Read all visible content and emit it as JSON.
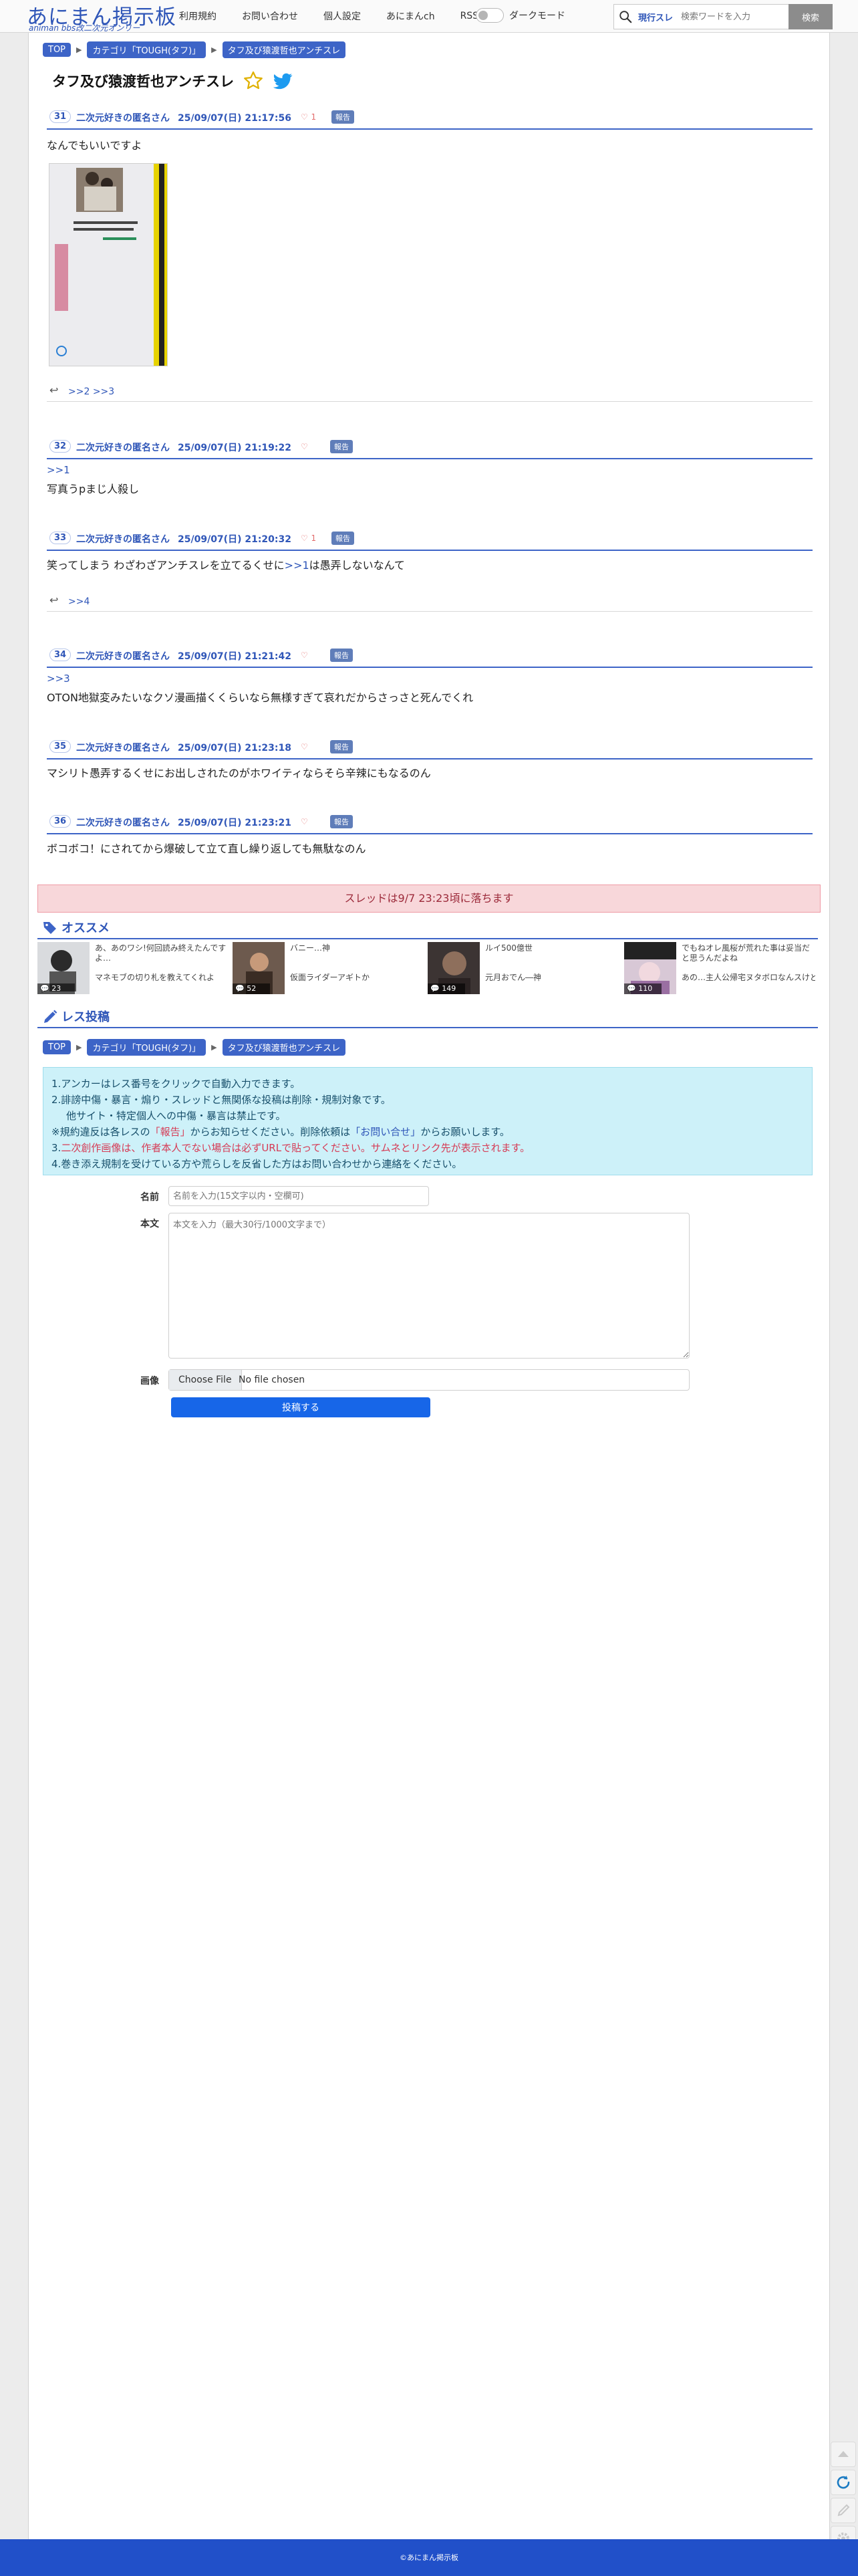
{
  "header": {
    "logo_main": "あにまん掲示板",
    "logo_sub": "animan bbs改二次元オンリー",
    "nav": [
      "利用規約",
      "お問い合わせ",
      "個人設定",
      "あにまんch",
      "RSS"
    ],
    "dark_mode_label": "ダークモード",
    "search_scope": "現行スレ",
    "search_placeholder": "検索ワードを入力",
    "search_button": "検索"
  },
  "breadcrumb": [
    "TOP",
    "カテゴリ「TOUGH(タフ)」",
    "タフ及び猿渡哲也アンチスレ"
  ],
  "thread": {
    "title": "タフ及び猿渡哲也アンチスレ"
  },
  "posts": [
    {
      "num": "31",
      "name": "二次元好きの匿名さん",
      "date": "25/09/07(日) 21:17:56",
      "likes": "1",
      "report": "報告",
      "body": "なんでもいいですよ",
      "replies": ">>2 >>3"
    },
    {
      "num": "32",
      "name": "二次元好きの匿名さん",
      "date": "25/09/07(日) 21:19:22",
      "likes": "",
      "report": "報告",
      "anchor": ">>1",
      "body": "写真うpまじ人殺し"
    },
    {
      "num": "33",
      "name": "二次元好きの匿名さん",
      "date": "25/09/07(日) 21:20:32",
      "likes": "1",
      "report": "報告",
      "body_pre": "笑ってしまう わざわざアンチスレを立てるくせに",
      "body_anchor": ">>1",
      "body_post": "は愚弄しないなんて",
      "replies": ">>4"
    },
    {
      "num": "34",
      "name": "二次元好きの匿名さん",
      "date": "25/09/07(日) 21:21:42",
      "likes": "",
      "report": "報告",
      "anchor": ">>3",
      "body": "OTON地獄変みたいなクソ漫画描くくらいなら無様すぎて哀れだからさっさと死んでくれ"
    },
    {
      "num": "35",
      "name": "二次元好きの匿名さん",
      "date": "25/09/07(日) 21:23:18",
      "likes": "",
      "report": "報告",
      "body": "マシリト愚弄するくせにお出しされたのがホワイティならそら辛辣にもなるのん"
    },
    {
      "num": "36",
      "name": "二次元好きの匿名さん",
      "date": "25/09/07(日) 21:23:21",
      "likes": "",
      "report": "報告",
      "body": "ボコボコ！にされてから爆破して立て直し繰り返しても無駄なのん"
    }
  ],
  "fall_notice": "スレッドは9/7 23:23頃に落ちます",
  "recommend": {
    "title": "オススメ",
    "items": [
      {
        "title": "あ、あのワシ!何回読み終えたんですよ…",
        "sub": "マネモブの切り札を教えてくれよ",
        "count": "23"
      },
      {
        "title": "バニー…神",
        "sub": "仮面ライダーアギトか",
        "count": "52"
      },
      {
        "title": "ルイ500億世",
        "sub": "元月おでん―神",
        "count": "149"
      },
      {
        "title": "でもねオレ風桜が荒れた事は妥当だと思うんだよね",
        "sub": "あの…主人公帰宅ヌタボロなんスけど…",
        "count": "110"
      }
    ]
  },
  "post_form": {
    "title": "レス投稿",
    "rules": [
      "1.アンカーはレス番号をクリックで自動入力できます。",
      "2.誹謗中傷・暴言・煽り・スレッドと無関係な投稿は削除・規制対象です。",
      "他サイト・特定個人への中傷・暴言は禁止です。",
      "※規約違反は各レスの",
      "「報告」",
      "からお知らせください。削除依頼は",
      "「お問い合せ」",
      "からお願いします。",
      "3.",
      "二次創作画像は、作者本人でない場合は必ずURLで貼ってください。サムネとリンク先が表示されます。",
      "4.巻き添え規制を受けている方や荒らしを反省した方はお問い合わせから連絡をください。"
    ],
    "name_label": "名前",
    "name_placeholder": "名前を入力(15文字以内・空欄可)",
    "body_label": "本文",
    "body_placeholder": "本文を入力（最大30行/1000文字まで）",
    "image_label": "画像",
    "file_button": "Choose File",
    "file_status": "No file chosen",
    "submit": "投稿する"
  },
  "footer": "©あにまん掲示板",
  "colors": {
    "accent": "#3d64c7",
    "link": "#2f56b8",
    "footer": "#2150c9",
    "submit": "#1766e8",
    "notice_bg": "#f8d7da",
    "rules_bg": "#cdf1f9"
  }
}
